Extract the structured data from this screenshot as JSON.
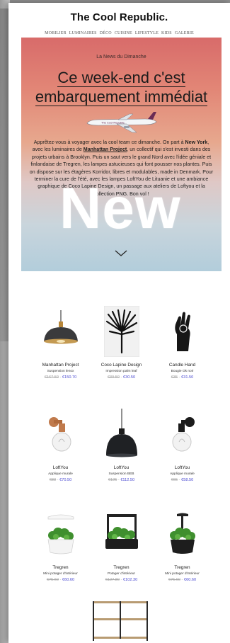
{
  "header": {
    "brand": "The Cool Republic.",
    "nav": [
      "MOBILIER",
      "LUMINAIRES",
      "DÉCO",
      "CUISINE",
      "LIFESTYLE",
      "KIDS",
      "GALERIE"
    ]
  },
  "hero": {
    "kicker": "La News du Dimanche",
    "title": "Ce week-end c'est embarquement immédiat",
    "body_intro": "Apprêtez-vous à voyager avec la cool team ce dimanche. On part à ",
    "body_city": "New York",
    "body_mid": ", avec les luminaires de ",
    "body_brand": "Manhattan Project",
    "body_rest": ", un collectif qui s'est investi dans des projets urbains à Brooklyn. Puis un saut vers le grand Nord avec l'idée géniale et finlandaise de Tregren, les lampes astucieuses qui font pousser nos plantes. Puis on dispose sur les étagères Korridor, libres et modulables, made in Denmark. Pour terminer la cure de l'été, avec les lampes LoftYou de Lituanie et une ambiance graphique de Coco Lapine Design, un passage aux ateliers de Loftyou et la collection PNG. Bon vol !",
    "watermark": "New",
    "colors": {
      "gradient_top": "#d86b6a",
      "gradient_bottom": "#b2cddb"
    },
    "chevron_icon": "chevron-down-icon"
  },
  "products": [
    {
      "name": "Manhattan Project",
      "sub": "Suspension lenox",
      "old": "€167.50",
      "new": "€150.70",
      "icon": "pendant-lamp-icon"
    },
    {
      "name": "Coco Lapine Design",
      "sub": "Impression palm leaf",
      "old": "€39.50",
      "new": "€30.50",
      "icon": "palm-leaf-print-icon"
    },
    {
      "name": "Candle Hand",
      "sub": "Bougie Ok noir",
      "old": "€35",
      "new": "€31.50",
      "icon": "hand-candle-icon"
    },
    {
      "name": "LoftYou",
      "sub": "Applique murale",
      "old": "€83",
      "new": "€70.50",
      "icon": "wall-lamp-copper-icon"
    },
    {
      "name": "LoftYou",
      "sub": "Suspension BEB",
      "old": "€125",
      "new": "€112.50",
      "icon": "black-pendant-icon"
    },
    {
      "name": "LoftYou",
      "sub": "Applique murale",
      "old": "€65",
      "new": "€58.50",
      "icon": "wall-lamp-black-icon"
    },
    {
      "name": "Tregren",
      "sub": "Mini potager d'intérieur",
      "old": "€75.60",
      "new": "€60.60",
      "icon": "herb-garden-white-icon"
    },
    {
      "name": "Tregren",
      "sub": "Potager d'intérieur",
      "old": "€127.80",
      "new": "€102.30",
      "icon": "herb-garden-black-icon"
    },
    {
      "name": "Tregren",
      "sub": "Mini potager d'intérieur",
      "old": "€75.60",
      "new": "€60.60",
      "icon": "herb-garden-pot-icon"
    }
  ],
  "price_separator": " - "
}
